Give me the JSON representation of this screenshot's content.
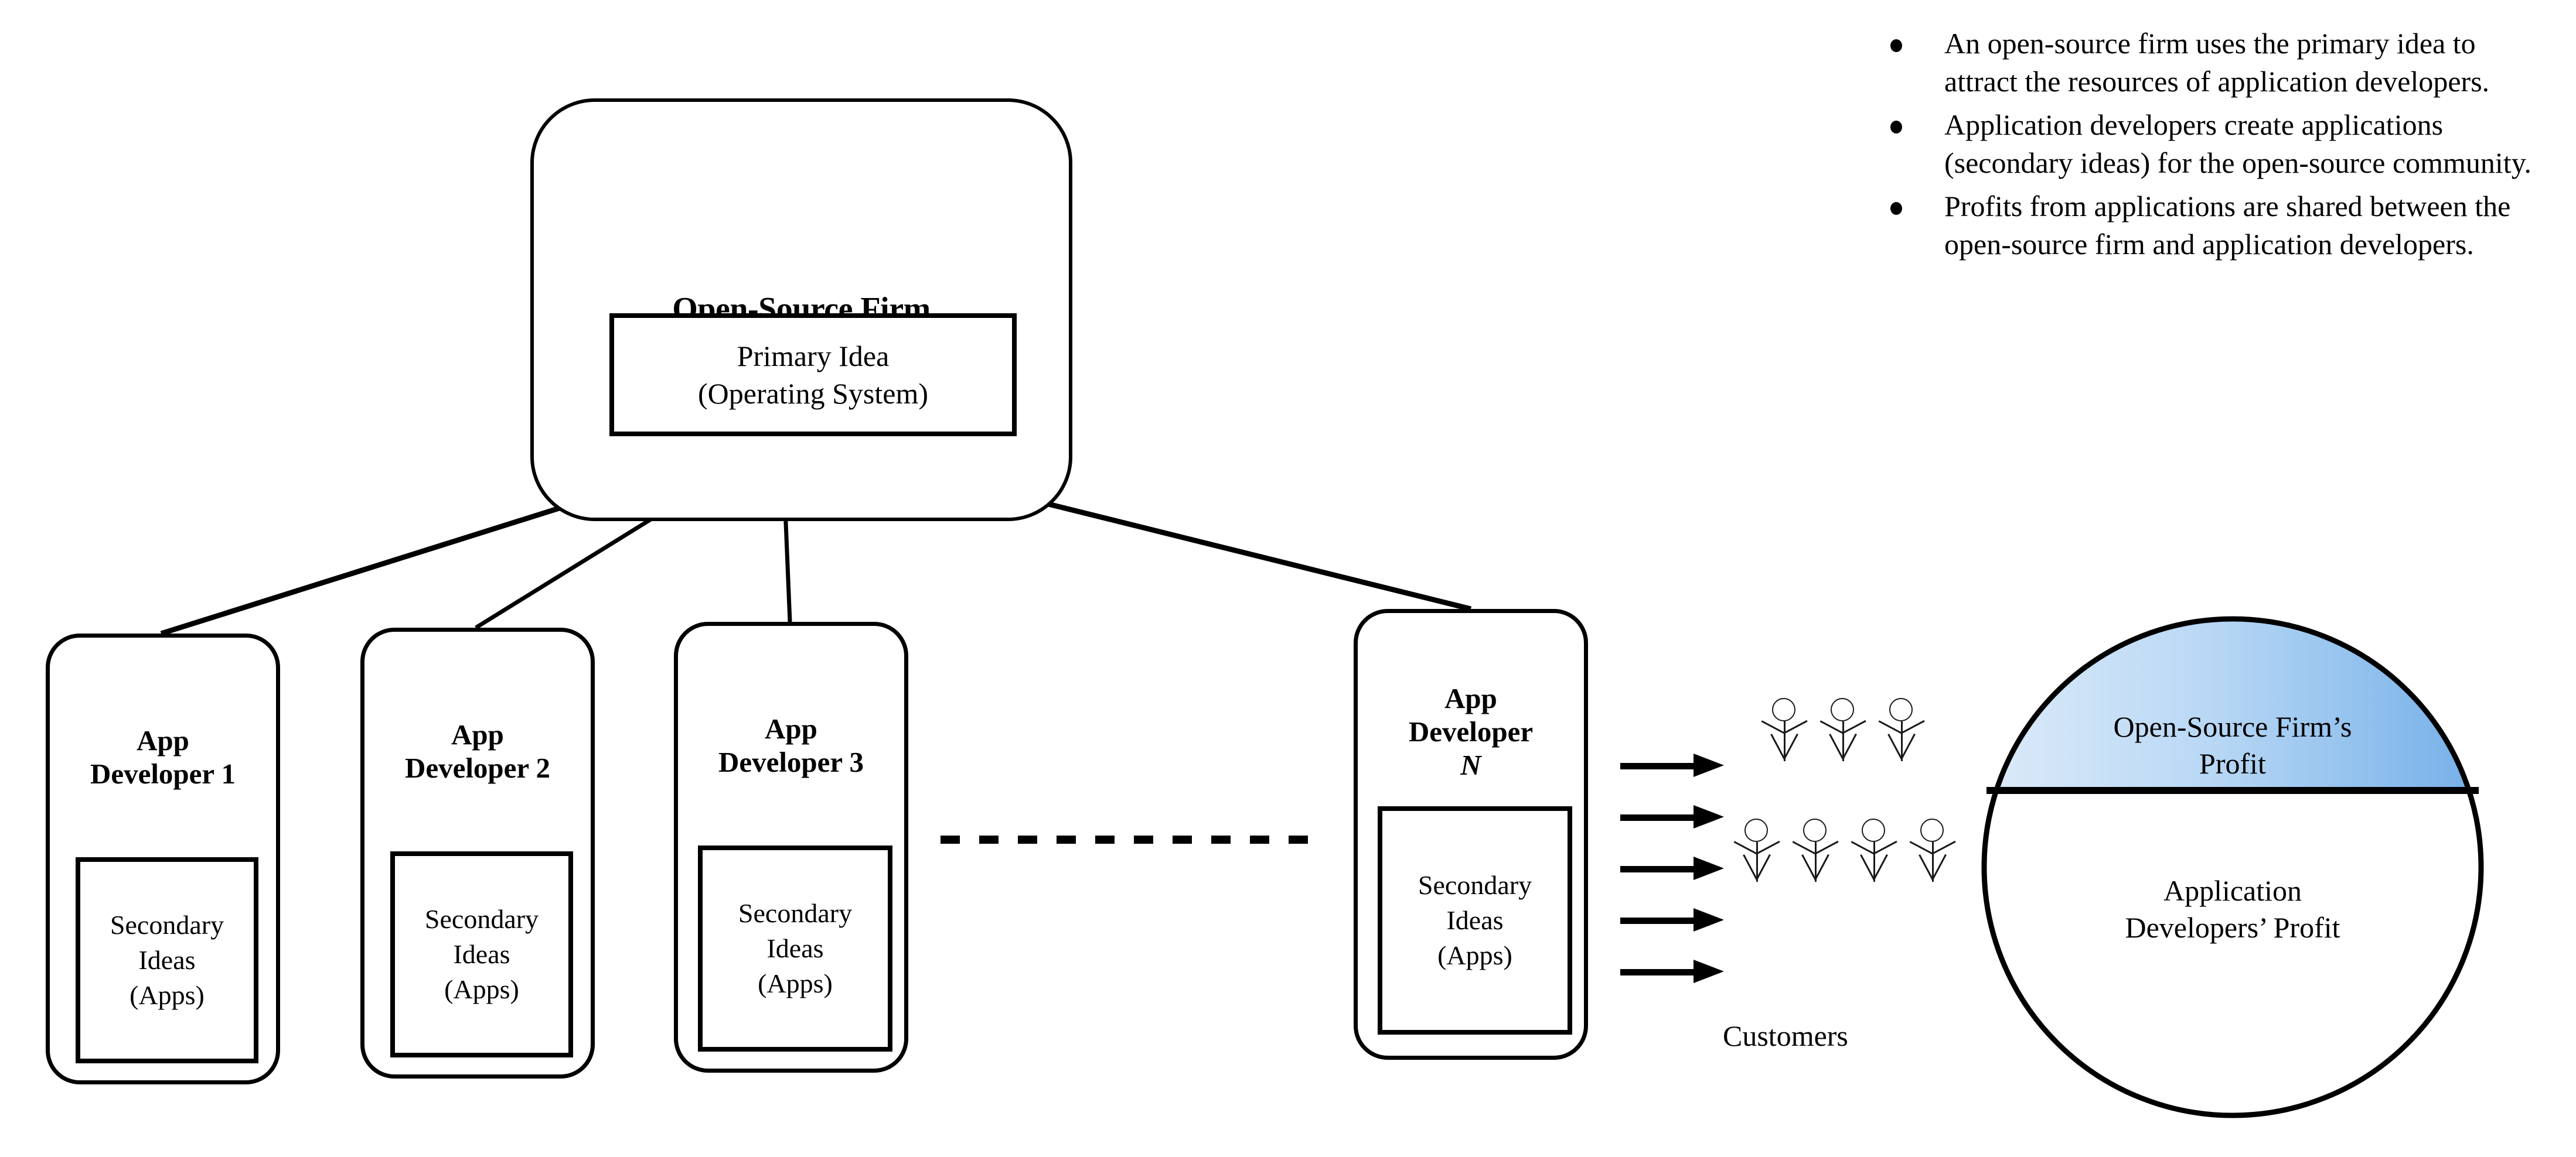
{
  "diagram": {
    "firm": {
      "title": "Open-Source Firm",
      "primary_idea_line1": "Primary Idea",
      "primary_idea_line2": "(Operating System)"
    },
    "developers": [
      {
        "title_line1": "App",
        "title_line2": "Developer 1",
        "inner_line1": "Secondary",
        "inner_line2": "Ideas",
        "inner_line3": "(Apps)"
      },
      {
        "title_line1": "App",
        "title_line2": "Developer 2",
        "inner_line1": "Secondary",
        "inner_line2": "Ideas",
        "inner_line3": "(Apps)"
      },
      {
        "title_line1": "App",
        "title_line2": "Developer 3",
        "inner_line1": "Secondary",
        "inner_line2": "Ideas",
        "inner_line3": "(Apps)"
      },
      {
        "title_line1": "App",
        "title_line2": "Developer",
        "title_line3": "N",
        "inner_line1": "Secondary",
        "inner_line2": "Ideas",
        "inner_line3": "(Apps)"
      }
    ],
    "customers": {
      "label": "Customers",
      "top_row_count": 3,
      "bottom_row_count": 4
    },
    "arrows": {
      "count": 5,
      "direction": "right"
    }
  },
  "chart_data": {
    "type": "pie",
    "title": "",
    "categories": [
      "Open-Source Firm's Profit",
      "Application Developers' Profit"
    ],
    "values": [
      35,
      65
    ],
    "labels": [
      {
        "line1": "Open-Source Firm’s",
        "line2": "Profit"
      },
      {
        "line1": "Application",
        "line2": "Developers’ Profit"
      }
    ],
    "colors": [
      "#a8cdf0",
      "#ffffff"
    ],
    "gradient": {
      "from": "#d9e9fa",
      "to": "#75b0e8"
    },
    "outline_color": "#000000",
    "legend": "none",
    "grid": false
  },
  "notes": {
    "bullets": [
      "An open-source firm uses the primary idea to attract the resources of application developers.",
      "Application developers create applications (secondary ideas) for the open-source community.",
      "Profits from applications are shared between the open-source firm and application developers."
    ]
  }
}
